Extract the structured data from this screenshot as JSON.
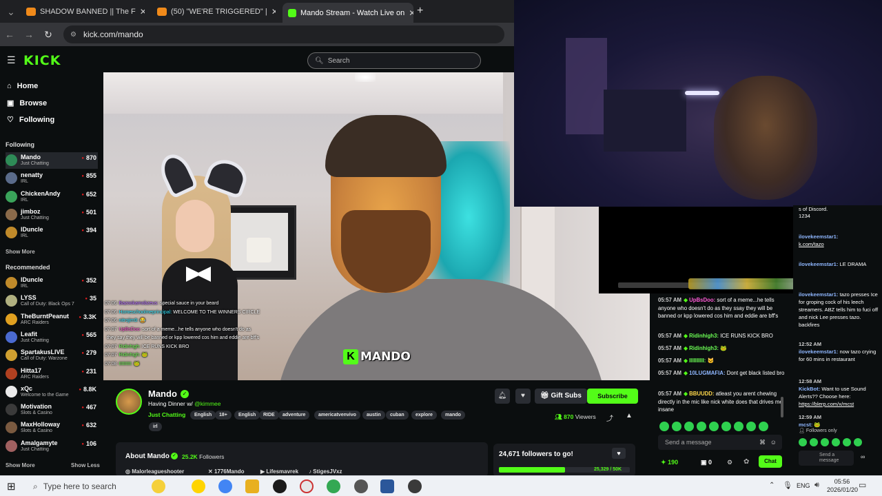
{
  "browser": {
    "tabs": [
      {
        "title": "SHADOW BANNED || The F",
        "active": false
      },
      {
        "title": "(50) \"WE'RE TRIGGERED\" | ",
        "active": false
      },
      {
        "title": "Mando Stream - Watch Live on",
        "active": true
      }
    ],
    "new_tab": "+",
    "url": "kick.com/mando"
  },
  "kick": {
    "logo": "KICK",
    "search_placeholder": "Search"
  },
  "sidebar": {
    "nav": [
      {
        "label": "Home",
        "icon": "home-icon"
      },
      {
        "label": "Browse",
        "icon": "browse-icon"
      },
      {
        "label": "Following",
        "icon": "heart-icon"
      }
    ],
    "following_title": "Following",
    "following": [
      {
        "name": "Mando",
        "category": "Just Chatting",
        "viewers": "870",
        "color": "#2e8b57"
      },
      {
        "name": "nenatty",
        "category": "IRL",
        "viewers": "855",
        "color": "#5a6b8a"
      },
      {
        "name": "ChickenAndy",
        "category": "IRL",
        "viewers": "652",
        "color": "#3aa35a"
      },
      {
        "name": "jimboz",
        "category": "Just Chatting",
        "viewers": "501",
        "color": "#8a6a4a"
      },
      {
        "name": "lDuncle",
        "category": "IRL",
        "viewers": "394",
        "color": "#c08a2a"
      }
    ],
    "show_more_1": "Show More",
    "recommended_title": "Recommended",
    "recommended": [
      {
        "name": "lDuncle",
        "category": "IRL",
        "viewers": "352",
        "color": "#c08a2a"
      },
      {
        "name": "LYSS",
        "category": "Call of Duty: Black Ops 7",
        "viewers": "35",
        "color": "#b0b080"
      },
      {
        "name": "TheBurntPeanut",
        "category": "ARC Raiders",
        "viewers": "3.3K",
        "color": "#e0a020"
      },
      {
        "name": "Leafit",
        "category": "Just Chatting",
        "viewers": "565",
        "color": "#4a6ad0"
      },
      {
        "name": "SpartakusLIVE",
        "category": "Call of Duty: Warzone",
        "viewers": "279",
        "color": "#d0a030"
      },
      {
        "name": "Hitta17",
        "category": "ARC Raiders",
        "viewers": "231",
        "color": "#b04020"
      },
      {
        "name": "xQc",
        "category": "Welcome to the Game",
        "viewers": "8.8K",
        "color": "#eaeaea"
      },
      {
        "name": "Motivation",
        "category": "Slots & Casino",
        "viewers": "467",
        "color": "#3a3a3a"
      },
      {
        "name": "MaxHolloway",
        "category": "Slots & Casino",
        "viewers": "632",
        "color": "#7a5a40"
      },
      {
        "name": "Amalgamyte",
        "category": "Just Chatting",
        "viewers": "106",
        "color": "#a06060"
      }
    ],
    "show_more_2": "Show More",
    "show_less": "Show Less"
  },
  "video": {
    "overlay_chat": [
      {
        "time": "07:06",
        "user": "Bazookamobzeus:",
        "ucls": "u1",
        "text": "special sauce in your beard"
      },
      {
        "time": "07:06",
        "user": "Homeschoolmeprincipal:",
        "ucls": "u2",
        "text": "WELCOME TO THE WINNERS CIRCLE"
      },
      {
        "time": "07:06",
        "user": "nitrojim9:",
        "ucls": "u2",
        "text": "😂"
      },
      {
        "time": "07:07",
        "user": "UpBsDoo:",
        "ucls": "u4",
        "text": "sort of a meme...he tells anyone who doesn't do as"
      },
      {
        "time": "",
        "user": "",
        "ucls": "u1",
        "text": "they say they will be banned or kpp lowered cos him and eddie are bff's"
      },
      {
        "time": "07:07",
        "user": "Ridinhigh:",
        "ucls": "u3",
        "text": "ICE RUNS KICK BRO"
      },
      {
        "time": "07:07",
        "user": "Ridinhigh:",
        "ucls": "u3",
        "text": "🐸"
      },
      {
        "time": "07:08",
        "user": "IIIIIIIII:",
        "ucls": "u3",
        "text": "🐸"
      }
    ],
    "watermark": "MANDO"
  },
  "stream": {
    "name": "Mando",
    "title_prefix": "Having Dinner w/ ",
    "title_mention": "@kimmee",
    "category": "Just Chatting",
    "tags": [
      "English",
      "18+",
      "English",
      "RIDE",
      "adventure",
      "americatvenvivo",
      "austin",
      "cuban",
      "explore",
      "mando",
      "irl"
    ],
    "gift_subs": "Gift Subs",
    "subscribe": "Subscribe",
    "viewers": "870",
    "viewers_label": "Viewers",
    "about_title": "About Mando",
    "followers": "25.2K",
    "followers_label": "Followers",
    "socials": [
      "Malorleagueshooter",
      "1776Mando",
      "Lifesmavrek",
      "StigesJVxz"
    ],
    "goal_title": "24,671 followers to go!",
    "goal_progress": "25,329 / 50K",
    "goal_fraction": 0.5066
  },
  "chat_main": {
    "messages": [
      {
        "time": "05:57 AM",
        "user": "UpBsDoo:",
        "color": "#ff5bd6",
        "text": "sort of a meme...he tells anyone who doesn't do as they ssay they will be banned or kpp lowered cos him and eddie are bff's"
      },
      {
        "time": "05:57 AM",
        "user": "Ridinhigh3:",
        "color": "#6cff54",
        "text": "ICE RUNS KICK BRO"
      },
      {
        "time": "05:57 AM",
        "user": "Ridinhigh3:",
        "color": "#6cff54",
        "text": "🐸"
      },
      {
        "time": "05:57 AM",
        "user": "IIIIIIIIII:",
        "color": "#6cff54",
        "text": "🐱"
      },
      {
        "time": "05:57 AM",
        "user": "10LUGMAFIA:",
        "color": "#8fb7ff",
        "text": "Dont get black listed bro"
      },
      {
        "time": "05:57 AM",
        "user": "BBUUDD:",
        "color": "#ffd84a",
        "text": "atleast you arent chewing directly in the mic like nick white does that drives me insane"
      }
    ],
    "send_placeholder": "Send a message",
    "points": "190",
    "zero": "0",
    "chat_button": "Chat"
  },
  "chat_side": {
    "messages": [
      {
        "ts": "",
        "user": "",
        "text": "s of Discord.",
        "link": ""
      },
      {
        "ts": "",
        "user": "",
        "text": "1234",
        "link": ""
      },
      {
        "ts": "",
        "user": "ilovekeemstar1:",
        "text": "",
        "link": "k.com/tazo"
      },
      {
        "ts": "",
        "user": "ilovekeemstar1:",
        "text": "LE DRAMA",
        "link": ""
      },
      {
        "ts": "",
        "user": "ilovekeemstar1:",
        "text": "tazo presses Ice for groping cock of his leech streamers. ABZ tells him to fuci off and nick Lee presses tazo. backfires",
        "link": ""
      },
      {
        "ts": "12:52 AM",
        "user": "ilovekeemstar1:",
        "text": "now tazo crying for 60 mins in restaurant",
        "link": ""
      },
      {
        "ts": "12:58 AM",
        "user": "KickBot:",
        "text": "Want to use Sound Alerts?? Choose here:",
        "link": "https://blerp.com/x/mcst"
      },
      {
        "ts": "12:59 AM",
        "user": "mcst:",
        "text": "🐸",
        "link": ""
      }
    ],
    "followers_only": "Followers only",
    "send_placeholder": "Send a message"
  },
  "taskbar": {
    "search_placeholder": "Type here to search",
    "lang": "ENG",
    "time": "05:56",
    "date": "2026/01/20"
  }
}
